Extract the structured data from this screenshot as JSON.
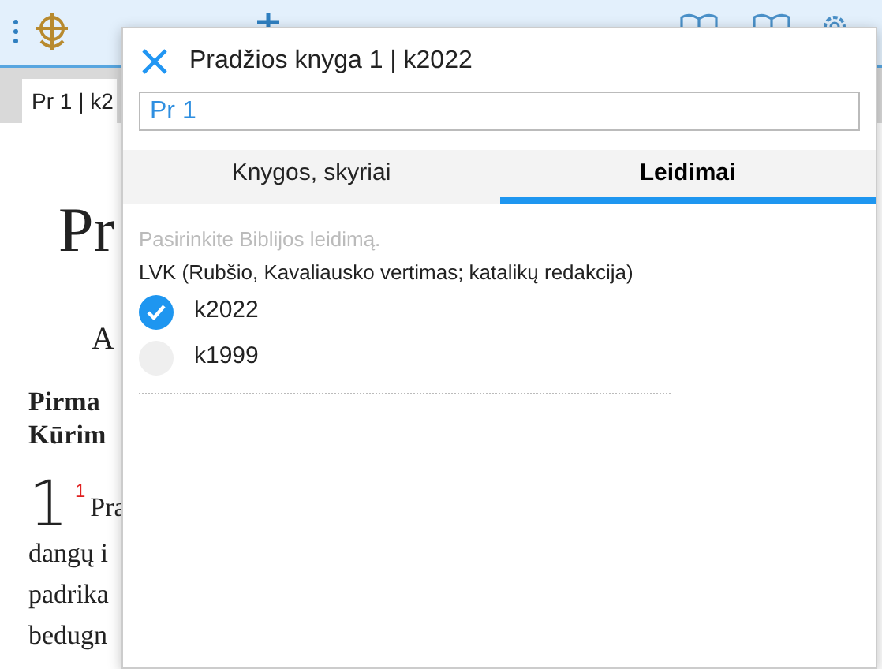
{
  "page": {
    "tab": "Pr 1 | k2",
    "title": "Pr",
    "subtitle": "A",
    "section_lines": [
      "Pirma",
      "Kūrim"
    ],
    "chapter": "1",
    "verse": "1",
    "text_lines": [
      "Pra",
      "dangų i",
      "padrika",
      "bedugn"
    ]
  },
  "dialog": {
    "title": "Pradžios knyga 1 | k2022",
    "search": {
      "value": "Pr 1"
    },
    "tabs": [
      {
        "label": "Knygos, skyriai",
        "selected": false
      },
      {
        "label": "Leidimai",
        "selected": true
      }
    ],
    "hint": "Pasirinkite Biblijos leidimą.",
    "group": {
      "abbr": "LVK",
      "name": "(Rubšio, Kavaliausko vertimas; katalikų redakcija)"
    },
    "editions": [
      {
        "label": "k2022",
        "checked": true
      },
      {
        "label": "k1999",
        "checked": false
      }
    ]
  }
}
